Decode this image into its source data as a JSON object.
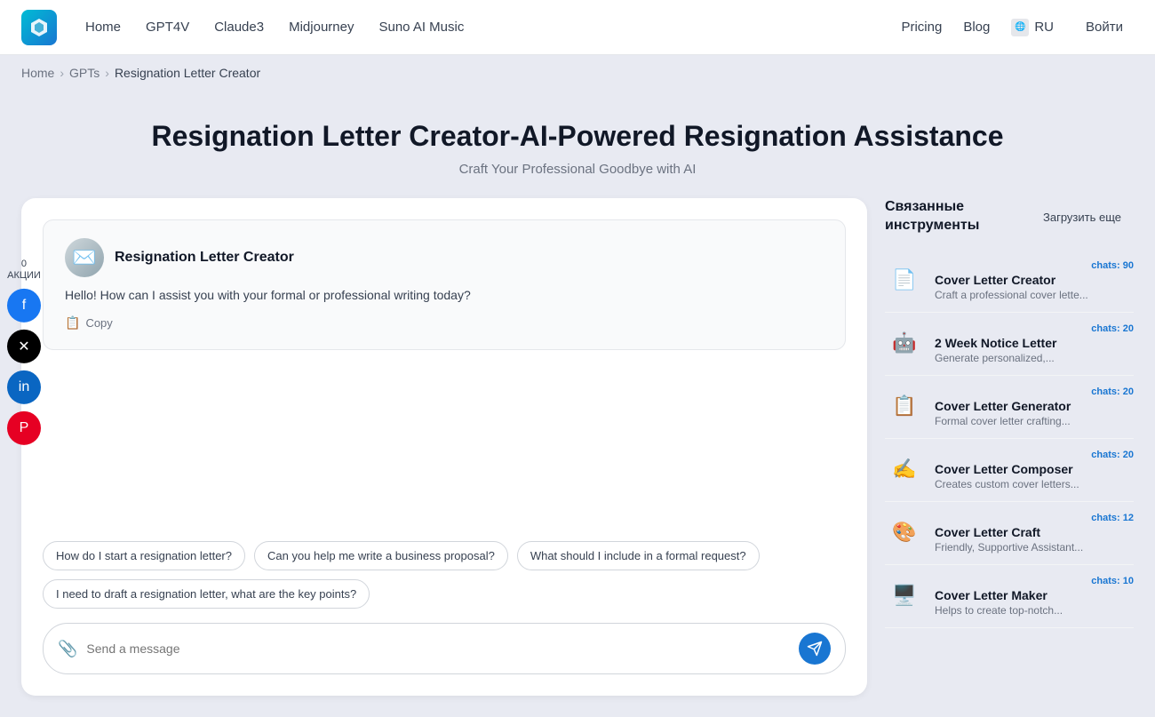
{
  "navbar": {
    "logo_alt": "AI Logo",
    "links": [
      {
        "label": "Home",
        "href": "#"
      },
      {
        "label": "GPT4V",
        "href": "#"
      },
      {
        "label": "Claude3",
        "href": "#"
      },
      {
        "label": "Midjourney",
        "href": "#"
      },
      {
        "label": "Suno AI Music",
        "href": "#"
      }
    ],
    "right_links": [
      {
        "label": "Pricing",
        "href": "#"
      },
      {
        "label": "Blog",
        "href": "#"
      }
    ],
    "lang": "RU",
    "login": "Войти"
  },
  "breadcrumb": {
    "home": "Home",
    "gpts": "GPTs",
    "current": "Resignation Letter Creator"
  },
  "hero": {
    "title": "Resignation Letter Creator-AI-Powered Resignation Assistance",
    "subtitle": "Craft Your Professional Goodbye with AI"
  },
  "social": {
    "count": "0",
    "label": "АКЦИИ"
  },
  "chat": {
    "bot_name": "Resignation Letter Creator",
    "bot_greeting": "Hello! How can I assist you with your formal or professional writing today?",
    "copy_label": "Copy",
    "input_placeholder": "Send a message",
    "suggestions": [
      "How do I start a resignation letter?",
      "Can you help me write a business proposal?",
      "What should I include in a formal request?",
      "I need to draft a resignation letter, what are the key points?"
    ]
  },
  "sidebar": {
    "title": "Связанные инструменты",
    "load_more": "Загрузить еще",
    "tools": [
      {
        "name": "Cover Letter Creator",
        "desc": "Craft a professional cover lette...",
        "chats": "chats: 90",
        "emoji": "📄"
      },
      {
        "name": "2 Week Notice Letter",
        "desc": "Generate personalized,...",
        "chats": "chats: 20",
        "emoji": "🤖"
      },
      {
        "name": "Cover Letter Generator",
        "desc": "Formal cover letter crafting...",
        "chats": "chats: 20",
        "emoji": "📋"
      },
      {
        "name": "Cover Letter Composer",
        "desc": "Creates custom cover letters...",
        "chats": "chats: 20",
        "emoji": "✍️"
      },
      {
        "name": "Cover Letter Craft",
        "desc": "Friendly, Supportive Assistant...",
        "chats": "chats: 12",
        "emoji": "🎨"
      },
      {
        "name": "Cover Letter Maker",
        "desc": "Helps to create top-notch...",
        "chats": "chats: 10",
        "emoji": "🖥️"
      }
    ]
  }
}
